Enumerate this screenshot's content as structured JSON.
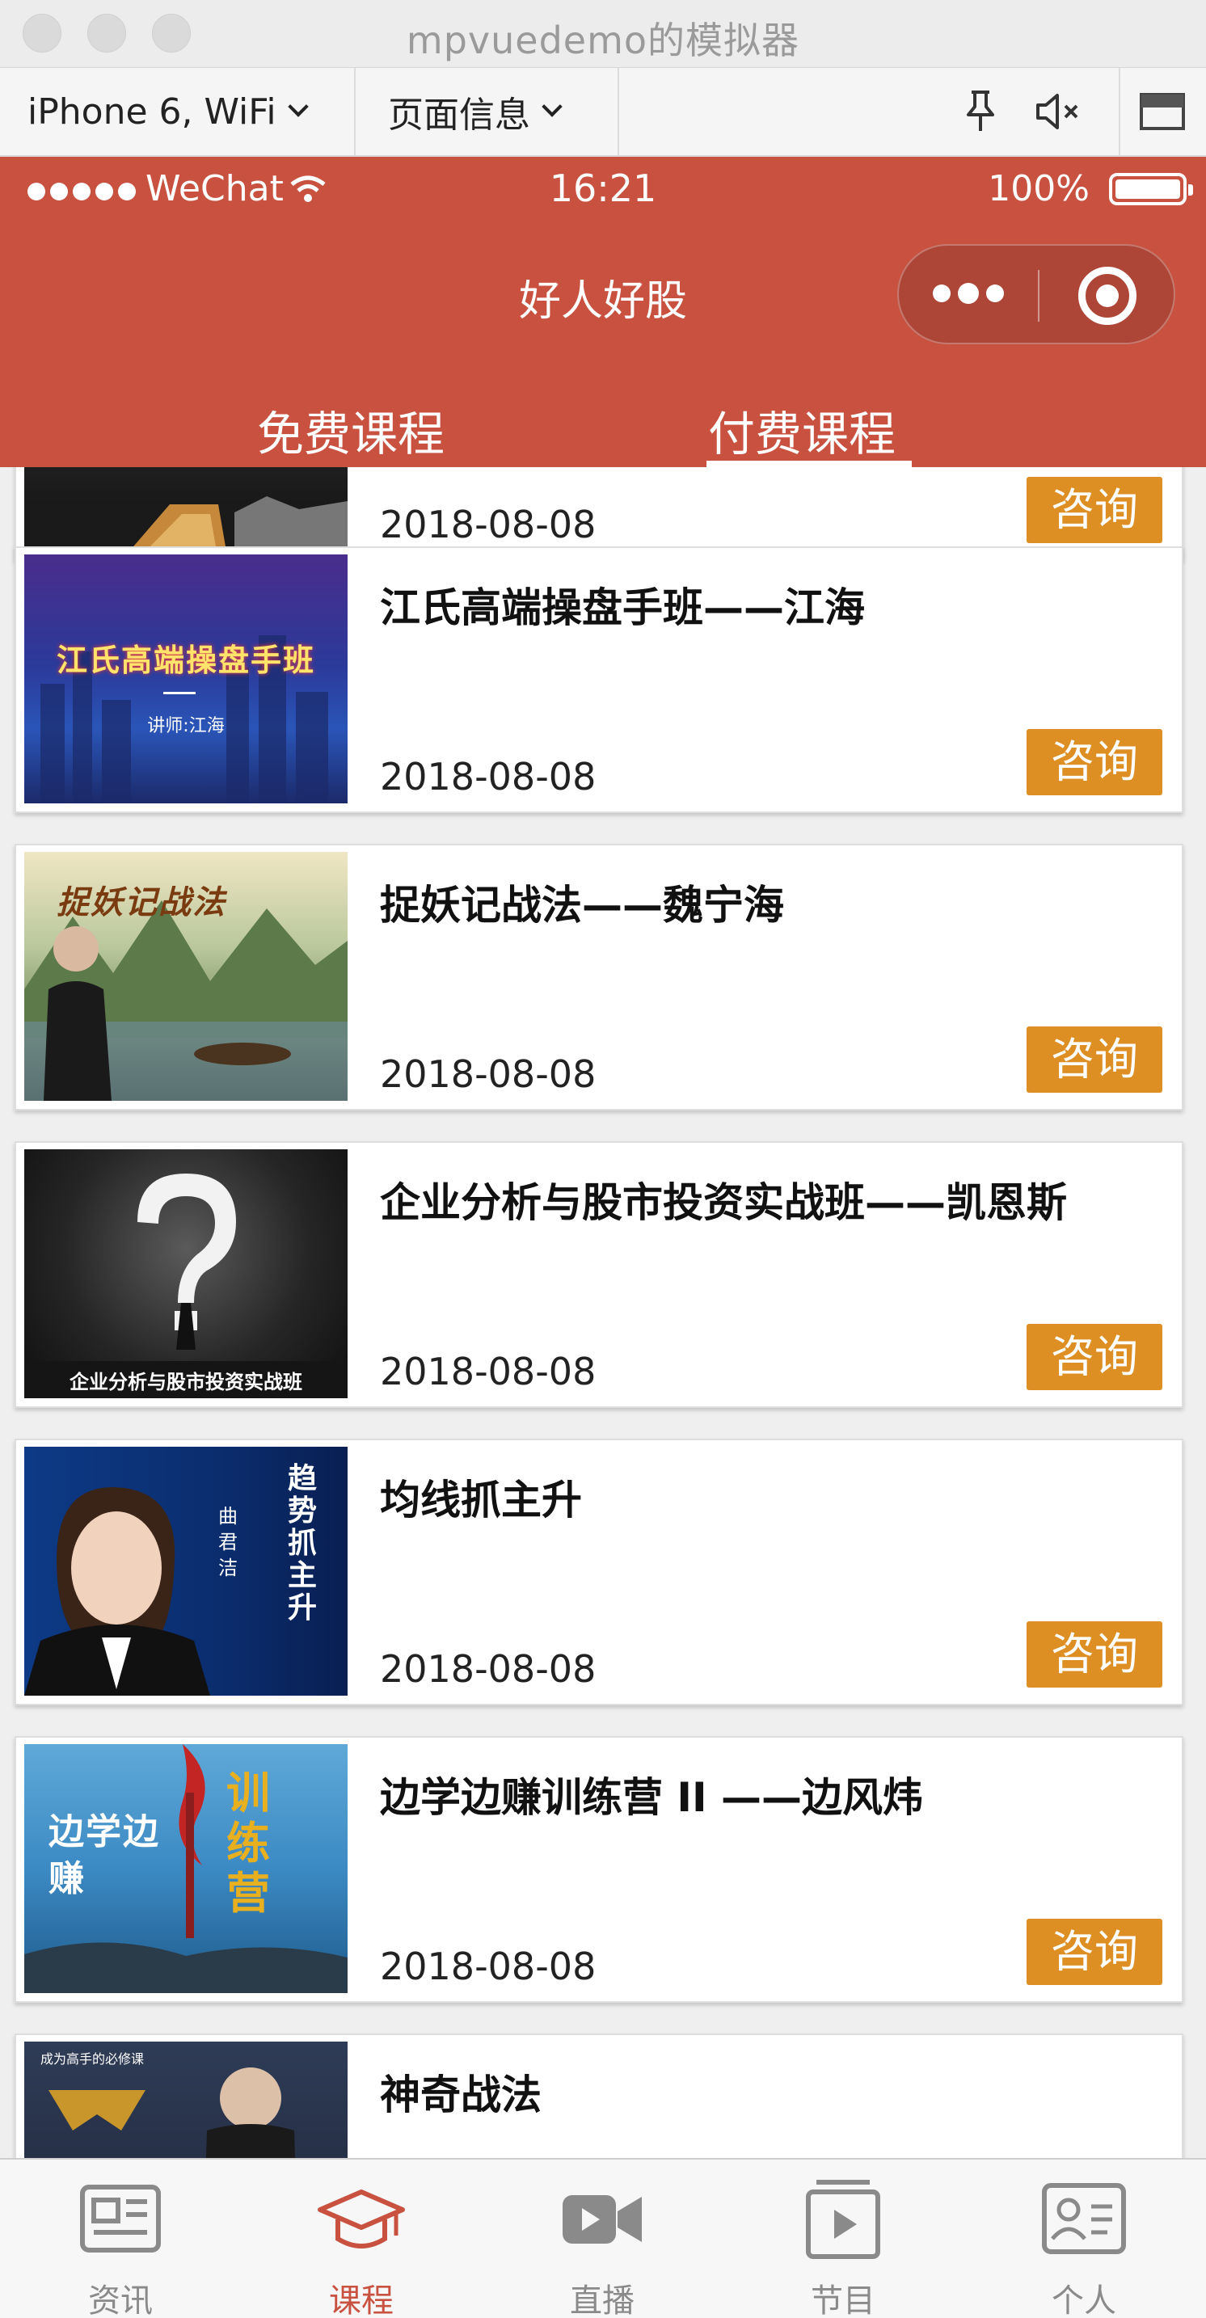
{
  "window": {
    "title": "mpvuedemo的模拟器"
  },
  "toolbar": {
    "device": "iPhone 6, WiFi",
    "page_info": "页面信息"
  },
  "statusbar": {
    "carrier": "WeChat",
    "time": "16:21",
    "battery": "100%"
  },
  "navbar": {
    "title": "好人好股"
  },
  "tabs": [
    {
      "label": "免费课程"
    },
    {
      "label": "付费课程"
    }
  ],
  "active_tab": 1,
  "consult_label": "咨询",
  "courses": [
    {
      "title": "",
      "date": "2018-08-08",
      "thumb_text": ""
    },
    {
      "title": "江氏高端操盘手班——江海",
      "date": "2018-08-08",
      "thumb_text": "江氏高端操盘手班",
      "thumb_sub": "讲师:江海"
    },
    {
      "title": "捉妖记战法——魏宁海",
      "date": "2018-08-08",
      "thumb_text": "捉妖记战法"
    },
    {
      "title": "企业分析与股市投资实战班——凯恩斯",
      "date": "2018-08-08",
      "thumb_text": "企业分析与股市投资实战班"
    },
    {
      "title": "均线抓主升",
      "date": "2018-08-08",
      "thumb_text": "趋势抓主升",
      "thumb_sub": "曲君洁"
    },
    {
      "title": "边学边赚训练营 II ——边风炜",
      "date": "2018-08-08",
      "thumb_text": "边学边赚",
      "thumb_sub": "训练营"
    },
    {
      "title": "神奇战法",
      "date": "",
      "thumb_text": "成为高手的必修课"
    }
  ],
  "tabbar": [
    {
      "label": "资讯",
      "icon": "news-icon"
    },
    {
      "label": "课程",
      "icon": "graduation-cap-icon"
    },
    {
      "label": "直播",
      "icon": "video-camera-icon"
    },
    {
      "label": "节目",
      "icon": "play-list-icon"
    },
    {
      "label": "个人",
      "icon": "profile-card-icon"
    }
  ],
  "active_tabbar": 1,
  "colors": {
    "brand": "#c85140",
    "consult": "#dd8f23",
    "tab_inactive": "#8a8a8a"
  }
}
